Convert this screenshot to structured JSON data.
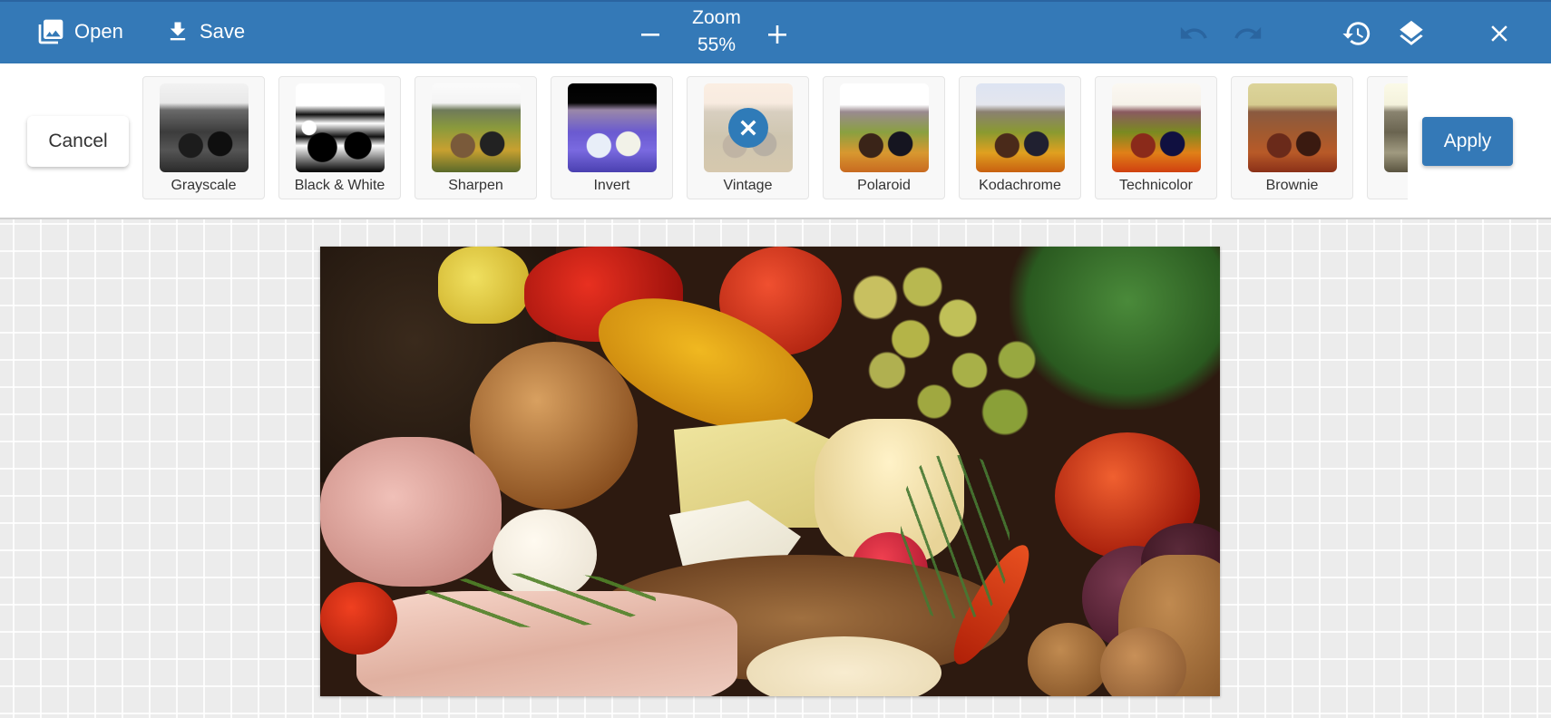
{
  "toolbar": {
    "open_label": "Open",
    "save_label": "Save",
    "zoom_title": "Zoom",
    "zoom_value": "55%",
    "icons": {
      "open": "image-library-icon",
      "save": "download-icon",
      "zoom_out": "minus-icon",
      "zoom_in": "plus-icon",
      "undo": "undo-icon",
      "redo": "redo-icon",
      "history": "history-icon",
      "layers": "layers-icon",
      "close": "close-icon"
    },
    "undo_enabled": false,
    "redo_enabled": false
  },
  "filter_bar": {
    "cancel_label": "Cancel",
    "apply_label": "Apply",
    "selected": "Vintage",
    "filters": [
      {
        "label": "Grayscale"
      },
      {
        "label": "Black & White"
      },
      {
        "label": "Sharpen"
      },
      {
        "label": "Invert"
      },
      {
        "label": "Vintage"
      },
      {
        "label": "Polaroid"
      },
      {
        "label": "Kodachrome"
      },
      {
        "label": "Technicolor"
      },
      {
        "label": "Brownie"
      },
      {
        "label": ""
      }
    ]
  },
  "canvas": {
    "image_description": "Still life of bread, cheeses, ham, grapes, peppers, tomatoes, radish, walnuts and fruit"
  },
  "colors": {
    "primary": "#3479b7",
    "toolbar_text": "#ffffff",
    "workspace_bg": "#ececec"
  }
}
